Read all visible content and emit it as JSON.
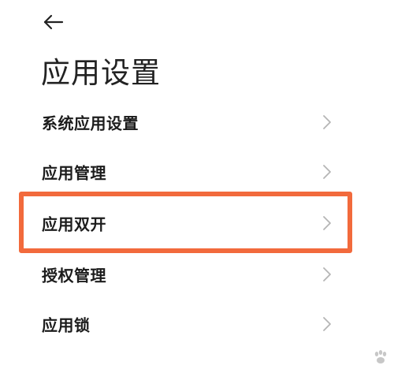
{
  "header": {
    "back_icon": "arrow-left-icon",
    "title": "应用设置"
  },
  "settings": {
    "items": [
      {
        "label": "系统应用设置",
        "icon": "chevron-right-icon"
      },
      {
        "label": "应用管理",
        "icon": "chevron-right-icon"
      },
      {
        "label": "应用双开",
        "icon": "chevron-right-icon",
        "highlighted": true
      },
      {
        "label": "授权管理",
        "icon": "chevron-right-icon"
      },
      {
        "label": "应用锁",
        "icon": "chevron-right-icon"
      }
    ]
  },
  "colors": {
    "highlight_border": "#f26a3c",
    "text_primary": "#1c1c1c",
    "chevron": "#b5b5b5",
    "background": "#ffffff"
  }
}
